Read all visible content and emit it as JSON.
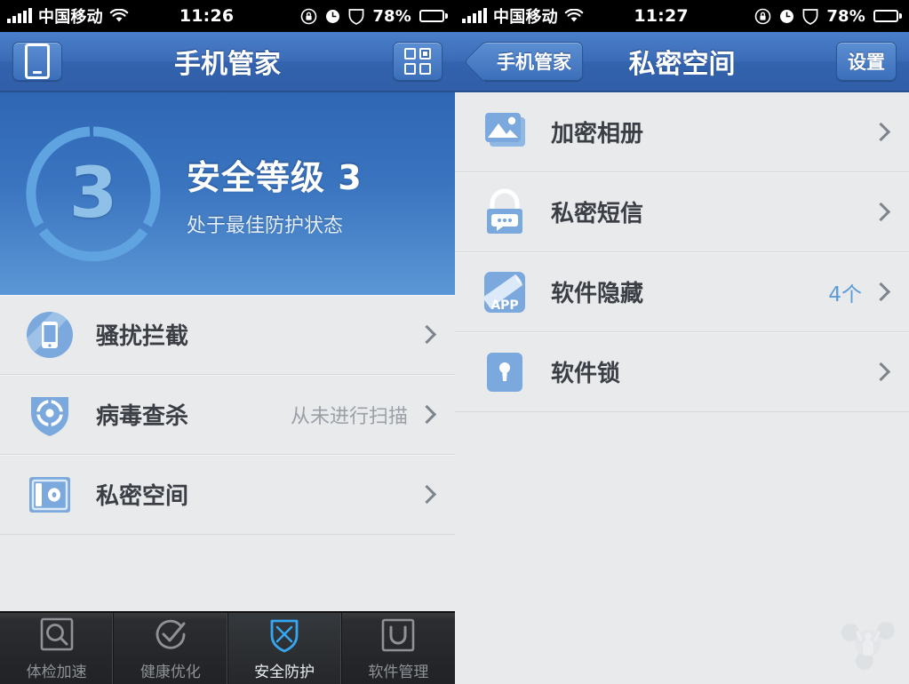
{
  "left": {
    "statusbar": {
      "carrier": "中国移动",
      "time": "11:26",
      "battery_pct": "78%",
      "signal_icon": "signal-bars-icon",
      "wifi_icon": "wifi-icon",
      "lock_icon": "rotation-lock-icon",
      "alarm_icon": "alarm-clock-icon",
      "shield_icon": "shield-icon",
      "battery_icon": "battery-icon"
    },
    "nav": {
      "title": "手机管家",
      "left_button_icon": "phone-icon",
      "right_button_icon": "grid-icon"
    },
    "hero": {
      "score": "3",
      "title": "安全等级 3",
      "subtitle": "处于最佳防护状态",
      "ring_segments": 3,
      "ring_color": "#5fa3e0"
    },
    "rows": [
      {
        "label": "骚扰拦截",
        "value": "",
        "icon": "phone-block-icon",
        "chevron": true
      },
      {
        "label": "病毒查杀",
        "value": "从未进行扫描",
        "icon": "shield-scan-icon",
        "chevron": true
      },
      {
        "label": "私密空间",
        "value": "",
        "icon": "safe-vault-icon",
        "chevron": true
      }
    ],
    "tabs": [
      {
        "label": "体检加速",
        "icon": "magnifier-icon",
        "active": false
      },
      {
        "label": "健康优化",
        "icon": "check-circle-icon",
        "active": false
      },
      {
        "label": "安全防护",
        "icon": "shield-swords-icon",
        "active": true
      },
      {
        "label": "软件管理",
        "icon": "app-bag-icon",
        "active": false
      }
    ]
  },
  "right": {
    "statusbar": {
      "carrier": "中国移动",
      "time": "11:27",
      "battery_pct": "78%"
    },
    "nav": {
      "back_label": "手机管家",
      "title": "私密空间",
      "right_button_label": "设置"
    },
    "rows": [
      {
        "label": "加密相册",
        "value": "",
        "icon": "photo-stack-icon",
        "chevron": true
      },
      {
        "label": "私密短信",
        "value": "",
        "icon": "lock-message-icon",
        "chevron": true
      },
      {
        "label": "软件隐藏",
        "value": "4个",
        "icon": "app-hide-icon",
        "chevron": true
      },
      {
        "label": "软件锁",
        "value": "",
        "icon": "app-lock-icon",
        "chevron": true
      }
    ],
    "watermark_icon": "watermark-logo-icon"
  },
  "theme": {
    "nav_blue": "#3c6cb8",
    "hero_blue": "#3a74bf",
    "accent_blue": "#5b9bd8",
    "list_bg": "#e8eaec",
    "tabbar_dark": "#25272a",
    "tab_active_blue": "#35a7f2"
  }
}
